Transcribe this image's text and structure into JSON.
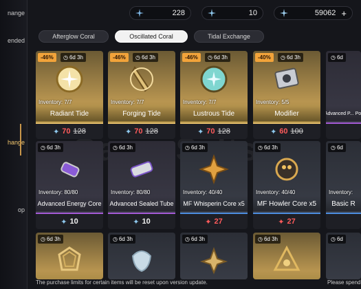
{
  "sidebar": {
    "items": [
      {
        "label": "nange"
      },
      {
        "label": "ended"
      },
      {
        "label": "hange"
      },
      {
        "label": "op"
      }
    ]
  },
  "currencies": [
    {
      "icon": "astrite-icon",
      "value": "228"
    },
    {
      "icon": "lunite-icon",
      "value": "10"
    },
    {
      "icon": "coral-icon",
      "value": "59062",
      "has_plus": true
    }
  ],
  "tabs": [
    {
      "label": "Afterglow Coral",
      "active": false
    },
    {
      "label": "Oscillated Coral",
      "active": true
    },
    {
      "label": "Tidal Exchange",
      "active": false
    }
  ],
  "watermark": "Game Salts",
  "cards": [
    {
      "discount": "-46%",
      "timer": "6d 3h",
      "inventory": "Inventory: 7/7",
      "name": "Radiant Tide",
      "price": "70",
      "old_price": "128",
      "rarity": "gold"
    },
    {
      "discount": "-46%",
      "timer": "6d 3h",
      "inventory": "Inventory: 7/7",
      "name": "Forging Tide",
      "price": "70",
      "old_price": "128",
      "rarity": "gold"
    },
    {
      "discount": "-46%",
      "timer": "6d 3h",
      "inventory": "Inventory: 7/7",
      "name": "Lustrous Tide",
      "price": "70",
      "old_price": "128",
      "rarity": "gold"
    },
    {
      "discount": "-40%",
      "timer": "6d 3h",
      "inventory": "Inventory: 5/5",
      "name": "Modifier",
      "price": "60",
      "old_price": "100",
      "rarity": "gold"
    },
    {
      "discount": "",
      "timer": "6d",
      "inventory": "",
      "name": "Advanced P... Pot",
      "price": "",
      "old_price": "",
      "rarity": "purple"
    },
    {
      "discount": "",
      "timer": "6d 3h",
      "inventory": "Inventory: 80/80",
      "name": "Advanced Energy Core",
      "price": "10",
      "old_price": "",
      "rarity": "purple"
    },
    {
      "discount": "",
      "timer": "6d 3h",
      "inventory": "Inventory: 80/80",
      "name": "Advanced Sealed Tube",
      "price": "10",
      "old_price": "",
      "rarity": "purple"
    },
    {
      "discount": "",
      "timer": "6d 3h",
      "inventory": "Inventory: 40/40",
      "name": "MF Whisperin Core x5",
      "price": "27",
      "old_price": "",
      "rarity": "blue"
    },
    {
      "discount": "",
      "timer": "6d 3h",
      "inventory": "Inventory: 40/40",
      "name": "MF Howler Core x5",
      "price": "27",
      "old_price": "",
      "rarity": "blue"
    },
    {
      "discount": "",
      "timer": "6d",
      "inventory": "Inventory:",
      "name": "Basic R",
      "price": "",
      "old_price": "",
      "rarity": "blue"
    },
    {
      "discount": "",
      "timer": "6d 3h",
      "name": "",
      "rarity": "gold"
    },
    {
      "discount": "",
      "timer": "6d 3h",
      "name": "",
      "rarity": "blue"
    },
    {
      "discount": "",
      "timer": "6d 3h",
      "name": "",
      "rarity": "blue"
    },
    {
      "discount": "",
      "timer": "6d 3h",
      "name": "",
      "rarity": "gold"
    },
    {
      "discount": "",
      "timer": "6d",
      "name": "",
      "rarity": "blue"
    }
  ],
  "footer": {
    "note": "The purchase limits for certain items will be reset upon version update.",
    "right": "Please spend"
  },
  "colors": {
    "accent_gold": "#e8c16c",
    "purple": "#a45ad6",
    "blue": "#4c8de0",
    "discount_red": "#ff5b5b"
  }
}
